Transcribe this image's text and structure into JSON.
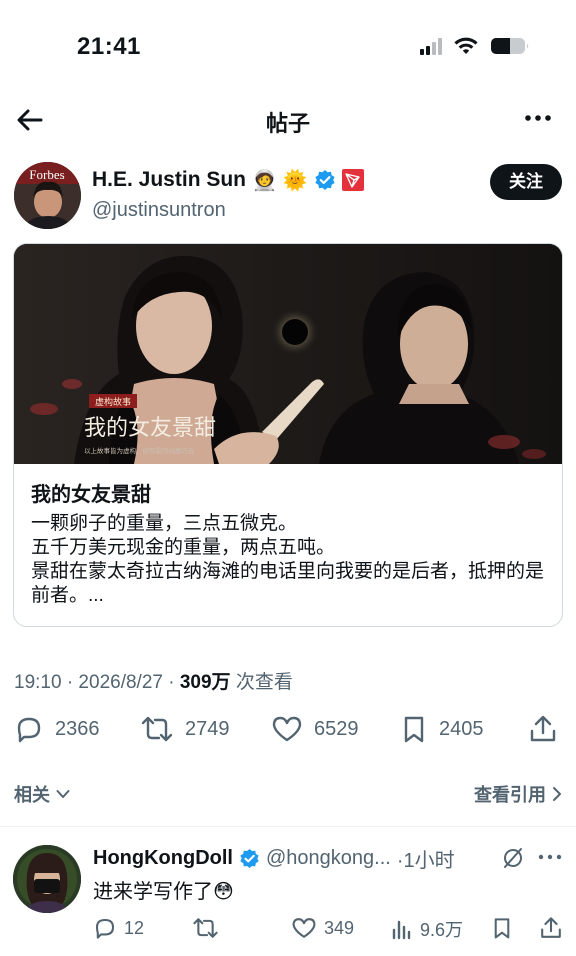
{
  "status_bar": {
    "time": "21:41"
  },
  "nav": {
    "title": "帖子"
  },
  "author": {
    "name": "H.E. Justin Sun",
    "emoji_1": "🧑‍🚀",
    "emoji_2": "🌞",
    "handle": "@justinsuntron",
    "avatar_text": "Forbes",
    "follow_label": "关注"
  },
  "card": {
    "image_badge": "虚构故事",
    "image_title": "我的女友景甜",
    "image_subtitle": "以上故事皆为虚构，如有雷同纯属巧合",
    "title": "我的女友景甜",
    "description_lines": [
      "一颗卵子的重量，三点五微克。",
      "五千万美元现金的重量，两点五吨。",
      "景甜在蒙太奇拉古纳海滩的电话里向我要的是后者，抵押的是前者。..."
    ]
  },
  "meta": {
    "timestamp": "19:10 · 2026/8/27 · ",
    "views": "309万",
    "views_suffix": " 次查看"
  },
  "actions": {
    "replies": "2366",
    "reposts": "2749",
    "likes": "6529",
    "bookmarks": "2405"
  },
  "related": {
    "related_label": "相关",
    "quotes_label": "查看引用"
  },
  "reply": {
    "name": "HongKongDoll",
    "handle": "@hongkong...",
    "time": "·1小时",
    "text": "进来学写作了😳",
    "replies": "12",
    "likes": "349",
    "views": "9.6万"
  },
  "colors": {
    "text_primary": "#0f1419",
    "text_secondary": "#536471",
    "verified_blue": "#1d9bf0",
    "tron_red": "#e5313c",
    "border": "#cfd9de"
  }
}
